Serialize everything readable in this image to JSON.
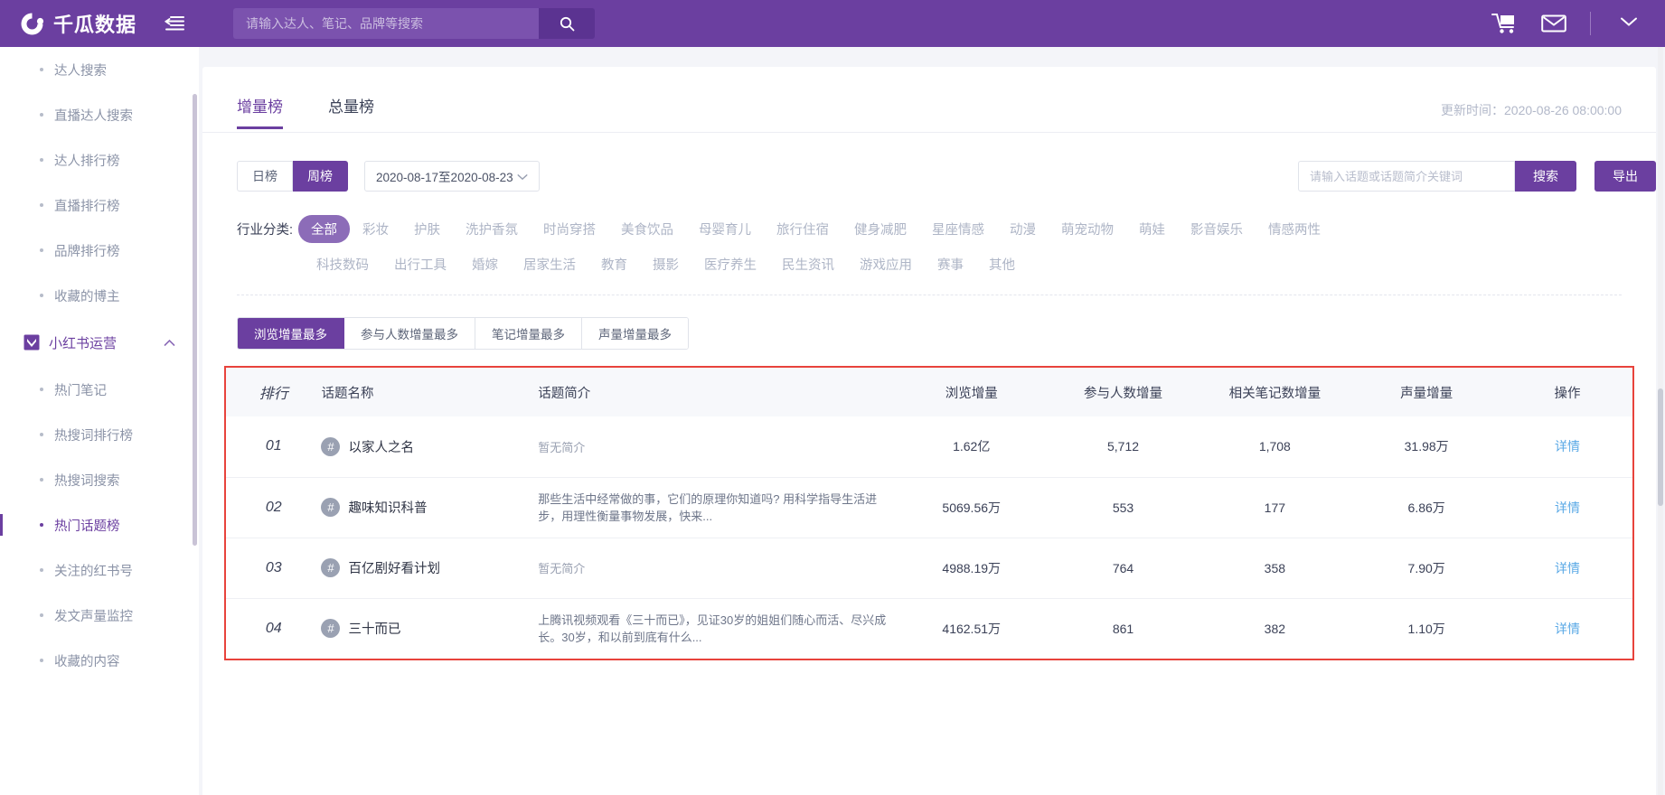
{
  "brand": {
    "name": "千瓜数据",
    "logo_icon": "crescent-logo-icon"
  },
  "topbar": {
    "collapse_icon": "collapse-menu-icon",
    "search_placeholder": "请输入达人、笔记、品牌等搜索",
    "search_value": "",
    "search_button_icon": "search-icon",
    "cart_icon": "shopping-cart-icon",
    "mail_icon": "envelope-icon",
    "caret_icon": "chevron-down-icon",
    "accent": "#6b3fa0"
  },
  "sidebar": {
    "items": [
      {
        "label": "达人搜索",
        "type": "sub",
        "active": false
      },
      {
        "label": "直播达人搜索",
        "type": "sub",
        "active": false
      },
      {
        "label": "达人排行榜",
        "type": "sub",
        "active": false
      },
      {
        "label": "直播排行榜",
        "type": "sub",
        "active": false
      },
      {
        "label": "品牌排行榜",
        "type": "sub",
        "active": false
      },
      {
        "label": "收藏的博主",
        "type": "sub",
        "active": false
      },
      {
        "label": "小红书运营",
        "type": "group",
        "icon": "bookmark-icon",
        "caret": "chevron-up-icon",
        "expanded": true
      },
      {
        "label": "热门笔记",
        "type": "sub",
        "active": false
      },
      {
        "label": "热搜词排行榜",
        "type": "sub",
        "active": false
      },
      {
        "label": "热搜词搜索",
        "type": "sub",
        "active": false
      },
      {
        "label": "热门话题榜",
        "type": "sub",
        "active": true
      },
      {
        "label": "关注的红书号",
        "type": "sub",
        "active": false
      },
      {
        "label": "发文声量监控",
        "type": "sub",
        "active": false
      },
      {
        "label": "收藏的内容",
        "type": "sub",
        "active": false
      }
    ]
  },
  "main": {
    "tabs": [
      {
        "label": "增量榜",
        "active": true
      },
      {
        "label": "总量榜",
        "active": false
      }
    ],
    "update_time_label": "更新时间：",
    "update_time_value": "2020-08-26 08:00:00",
    "period": {
      "options": [
        {
          "label": "日榜",
          "active": false
        },
        {
          "label": "周榜",
          "active": true
        }
      ]
    },
    "date_range": {
      "value": "2020-08-17至2020-08-23",
      "caret_icon": "chevron-down-icon"
    },
    "topic_search": {
      "placeholder": "请输入话题或话题简介关键词",
      "value": "",
      "button_label": "搜索"
    },
    "export_label": "导出",
    "category": {
      "label": "行业分类:",
      "row1": [
        {
          "label": "全部",
          "active": true
        },
        {
          "label": "彩妆",
          "active": false
        },
        {
          "label": "护肤",
          "active": false
        },
        {
          "label": "洗护香氛",
          "active": false
        },
        {
          "label": "时尚穿搭",
          "active": false
        },
        {
          "label": "美食饮品",
          "active": false
        },
        {
          "label": "母婴育儿",
          "active": false
        },
        {
          "label": "旅行住宿",
          "active": false
        },
        {
          "label": "健身减肥",
          "active": false
        },
        {
          "label": "星座情感",
          "active": false
        },
        {
          "label": "动漫",
          "active": false
        },
        {
          "label": "萌宠动物",
          "active": false
        },
        {
          "label": "萌娃",
          "active": false
        },
        {
          "label": "影音娱乐",
          "active": false
        },
        {
          "label": "情感两性",
          "active": false
        }
      ],
      "row2": [
        {
          "label": "科技数码",
          "active": false
        },
        {
          "label": "出行工具",
          "active": false
        },
        {
          "label": "婚嫁",
          "active": false
        },
        {
          "label": "居家生活",
          "active": false
        },
        {
          "label": "教育",
          "active": false
        },
        {
          "label": "摄影",
          "active": false
        },
        {
          "label": "医疗养生",
          "active": false
        },
        {
          "label": "民生资讯",
          "active": false
        },
        {
          "label": "游戏应用",
          "active": false
        },
        {
          "label": "赛事",
          "active": false
        },
        {
          "label": "其他",
          "active": false
        }
      ]
    },
    "sort_tabs": [
      {
        "label": "浏览增量最多",
        "active": true
      },
      {
        "label": "参与人数增量最多",
        "active": false
      },
      {
        "label": "笔记增量最多",
        "active": false
      },
      {
        "label": "声量增量最多",
        "active": false
      }
    ],
    "table": {
      "highlight_color": "#e8433c",
      "columns": [
        "排行",
        "话题名称",
        "话题简介",
        "浏览增量",
        "参与人数增量",
        "相关笔记数增量",
        "声量增量",
        "操作"
      ],
      "rows": [
        {
          "rank": "01",
          "topic": "以家人之名",
          "desc": "暂无简介",
          "desc_empty": true,
          "views": "1.62亿",
          "participants": "5,712",
          "notes": "1,708",
          "voice": "31.98万",
          "action": "详情"
        },
        {
          "rank": "02",
          "topic": "趣味知识科普",
          "desc": "那些生活中经常做的事，它们的原理你知道吗? 用科学指导生活进步，用理性衡量事物发展，快来...",
          "desc_empty": false,
          "views": "5069.56万",
          "participants": "553",
          "notes": "177",
          "voice": "6.86万",
          "action": "详情"
        },
        {
          "rank": "03",
          "topic": "百亿剧好看计划",
          "desc": "暂无简介",
          "desc_empty": true,
          "views": "4988.19万",
          "participants": "764",
          "notes": "358",
          "voice": "7.90万",
          "action": "详情"
        },
        {
          "rank": "04",
          "topic": "三十而已",
          "desc": "上腾讯视频观看《三十而已》，见证30岁的姐姐们随心而活、尽兴成长。30岁，和以前到底有什么...",
          "desc_empty": false,
          "views": "4162.51万",
          "participants": "861",
          "notes": "382",
          "voice": "1.10万",
          "action": "详情"
        }
      ]
    }
  }
}
